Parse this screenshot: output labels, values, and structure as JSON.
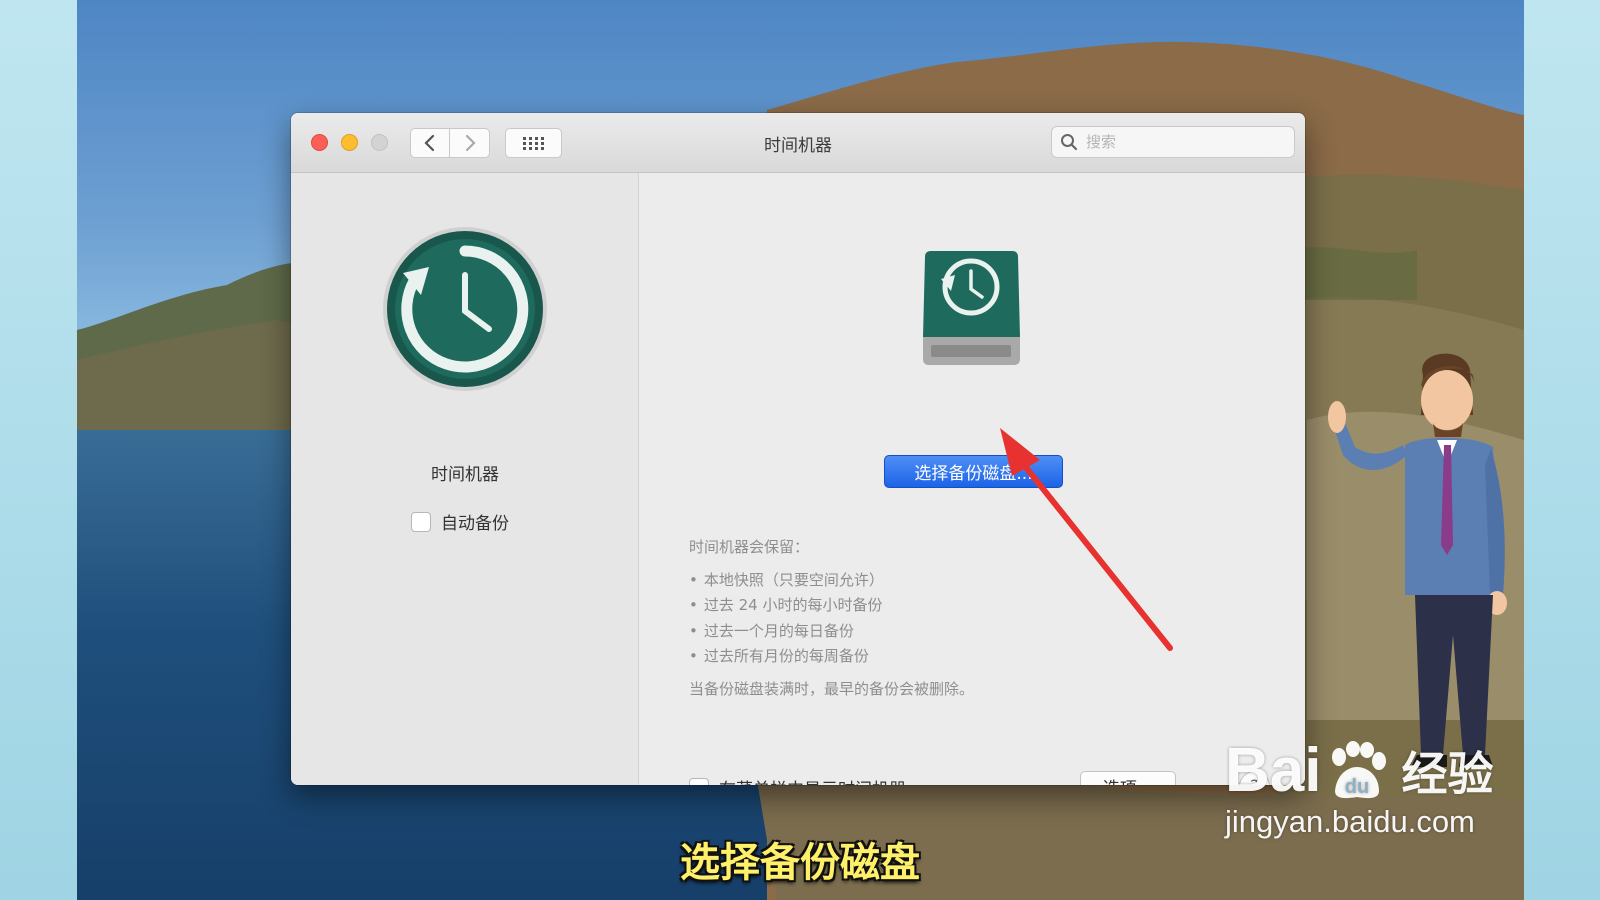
{
  "window": {
    "title": "时间机器",
    "search_placeholder": "搜索"
  },
  "sidebar": {
    "app_label": "时间机器",
    "auto_backup_label": "自动备份",
    "auto_backup_checked": false
  },
  "main": {
    "select_disk_button": "选择备份磁盘...",
    "info_heading": "时间机器会保留：",
    "info_items": [
      "本地快照（只要空间允许）",
      "过去 24 小时的每小时备份",
      "过去一个月的每日备份",
      "过去所有月份的每周备份"
    ],
    "info_note": "当备份磁盘装满时，最早的备份会被删除。",
    "show_in_menubar_label": "在菜单栏中显示时间机器",
    "show_in_menubar_checked": false,
    "options_button": "选项...",
    "help_button": "?"
  },
  "overlay": {
    "subtitle": "选择备份磁盘",
    "watermark_brand_left": "Bai",
    "watermark_brand_right": "经验",
    "watermark_url": "jingyan.baidu.com"
  },
  "colors": {
    "accent": "#1d63e6",
    "subtitle": "#fff06a",
    "arrow": "#e8322f",
    "tm_green": "#1e6a5c"
  },
  "icons": [
    "close-icon",
    "minimize-icon",
    "zoom-icon",
    "chevron-left-icon",
    "chevron-right-icon",
    "grid-icon",
    "search-icon",
    "time-machine-icon",
    "backup-disk-icon",
    "help-icon"
  ]
}
